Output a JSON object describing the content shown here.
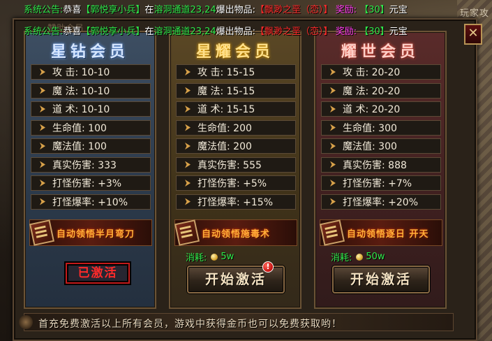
{
  "background": {
    "right_label": "玩家攻"
  },
  "announcements": [
    {
      "prefix": "系统公告:",
      "verb": "恭喜",
      "player": "【郭悦享小兵】",
      "at": "在",
      "location": "溶洞通道23,24",
      "drop": "爆出物品:",
      "item": "【飘渺之垩（恋）】",
      "reward_label": "奖励:",
      "reward_value": "【30】",
      "currency": "元宝"
    },
    {
      "prefix": "系统公告:",
      "verb": "恭喜",
      "player": "【郭悦享小兵】",
      "at": "在",
      "location": "溶洞通道23,24",
      "drop": "爆出物品:",
      "item": "【飘渺之垩（恋）】",
      "reward_label": "奖励:",
      "reward_value": "【30】",
      "currency": "元宝"
    }
  ],
  "panel": {
    "title": "赞助会员",
    "close_label": "✕",
    "footer_text": "首充免费激活以上所有会员，游戏中获得金币也可以免费获取哟！"
  },
  "tiers": [
    {
      "title": "星钻会员",
      "stats": [
        "攻 击: 10-10",
        "魔 法: 10-10",
        "道 术: 10-10",
        "生命值: 100",
        "魔法值: 100",
        "真实伤害: 333",
        "打怪伤害: +3%",
        "打怪爆率: +10%"
      ],
      "auto_text": "自动领悟半月弯刀",
      "status_label": "已激活"
    },
    {
      "title": "星耀会员",
      "stats": [
        "攻 击: 15-15",
        "魔 法: 15-15",
        "道 术: 15-15",
        "生命值: 200",
        "魔法值: 200",
        "真实伤害: 555",
        "打怪伤害: +5%",
        "打怪爆率: +15%"
      ],
      "auto_text": "自动领悟施毒术",
      "cost_label": "消耗:",
      "cost_value": "5w",
      "button_label": "开始激活",
      "alert": "!"
    },
    {
      "title": "耀世会员",
      "stats": [
        "攻 击: 20-20",
        "魔 法: 20-20",
        "道 术: 20-20",
        "生命值: 300",
        "魔法值: 300",
        "真实伤害: 888",
        "打怪伤害: +7%",
        "打怪爆率: +20%"
      ],
      "auto_text": "自动领悟逐日 开天",
      "cost_label": "消耗:",
      "cost_value": "50w",
      "button_label": "开始激活"
    }
  ],
  "colors": {
    "announce_green": "#2fe84a",
    "announce_red": "#ff2a2a",
    "announce_magenta": "#ff3cf0",
    "activated_red": "#ff2a2a"
  }
}
